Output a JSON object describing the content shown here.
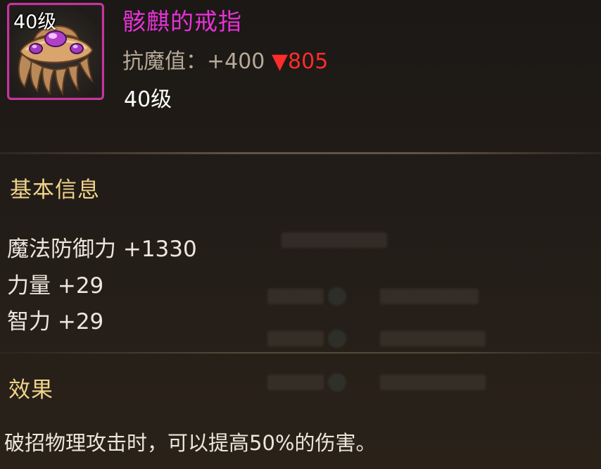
{
  "item": {
    "icon_name": "skeleton-claw-ring-icon",
    "icon_level": "40级",
    "name": "骸麒的戒指",
    "name_color": "#e632d6",
    "frame_color": "#c2379b",
    "stat_label": "抗魔值：+400",
    "stat_delta_arrow": "▼",
    "stat_delta_value": "805",
    "delta_color": "#ff2c2c",
    "level": "40级"
  },
  "basic_info": {
    "heading": "基本信息",
    "heading_color": "#f1d48a",
    "attributes": [
      {
        "text": "魔法防御力 +1330"
      },
      {
        "text": "力量 +29"
      },
      {
        "text": "智力 +29"
      }
    ]
  },
  "effect": {
    "heading": "效果",
    "description": "破招物理攻击时，可以提高50%的伤害。"
  }
}
